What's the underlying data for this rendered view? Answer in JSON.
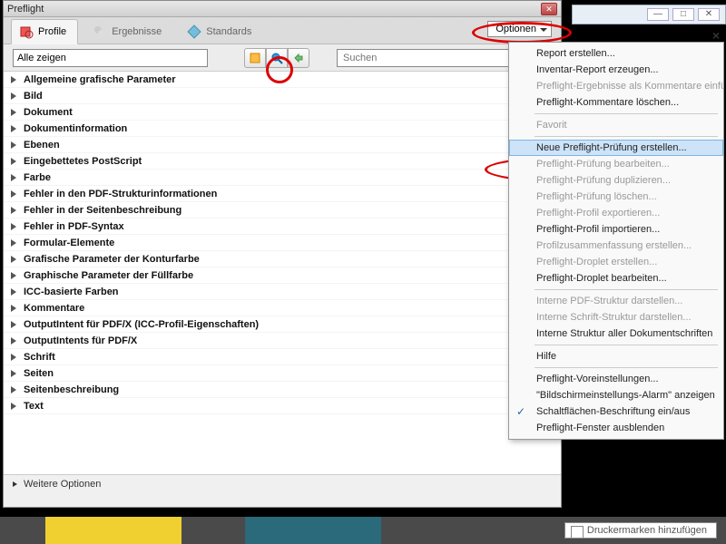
{
  "window": {
    "title": "Preflight"
  },
  "tabs": [
    {
      "label": "Profile"
    },
    {
      "label": "Ergebnisse"
    },
    {
      "label": "Standards"
    }
  ],
  "options_button": "Optionen",
  "filter": {
    "value": "Alle zeigen",
    "search_placeholder": "Suchen"
  },
  "tree": [
    "Allgemeine grafische Parameter",
    "Bild",
    "Dokument",
    "Dokumentinformation",
    "Ebenen",
    "Eingebettetes PostScript",
    "Farbe",
    "Fehler in den PDF-Strukturinformationen",
    "Fehler in der Seitenbeschreibung",
    "Fehler in PDF-Syntax",
    "Formular-Elemente",
    "Grafische Parameter der Konturfarbe",
    "Graphische Parameter der Füllfarbe",
    "ICC-basierte Farben",
    "Kommentare",
    "OutputIntent für PDF/X (ICC-Profil-Eigenschaften)",
    "OutputIntents für PDF/X",
    "Schrift",
    "Seiten",
    "Seitenbeschreibung",
    "Text"
  ],
  "footer": {
    "more_options": "Weitere Optionen"
  },
  "menu": {
    "groups": [
      [
        {
          "label": "Report erstellen..."
        },
        {
          "label": "Inventar-Report erzeugen..."
        },
        {
          "label": "Preflight-Ergebnisse als Kommentare einfügen",
          "disabled": true
        },
        {
          "label": "Preflight-Kommentare löschen..."
        }
      ],
      [
        {
          "label": "Favorit",
          "disabled": true
        }
      ],
      [
        {
          "label": "Neue Preflight-Prüfung erstellen...",
          "highlight": true
        },
        {
          "label": "Preflight-Prüfung bearbeiten...",
          "disabled": true
        },
        {
          "label": "Preflight-Prüfung duplizieren...",
          "disabled": true
        },
        {
          "label": "Preflight-Prüfung löschen...",
          "disabled": true
        },
        {
          "label": "Preflight-Profil exportieren...",
          "disabled": true
        },
        {
          "label": "Preflight-Profil importieren..."
        },
        {
          "label": "Profilzusammenfassung erstellen...",
          "disabled": true
        },
        {
          "label": "Preflight-Droplet erstellen...",
          "disabled": true
        },
        {
          "label": "Preflight-Droplet bearbeiten..."
        }
      ],
      [
        {
          "label": "Interne PDF-Struktur darstellen...",
          "disabled": true
        },
        {
          "label": "Interne Schrift-Struktur darstellen...",
          "disabled": true
        },
        {
          "label": "Interne Struktur aller Dokumentschriften"
        }
      ],
      [
        {
          "label": "Hilfe"
        }
      ],
      [
        {
          "label": "Preflight-Voreinstellungen..."
        },
        {
          "label": "\"Bildschirmeinstellungs-Alarm\" anzeigen"
        },
        {
          "label": "Schaltflächen-Beschriftung ein/aus",
          "checked": true
        },
        {
          "label": "Preflight-Fenster ausblenden"
        }
      ]
    ]
  },
  "status_bar": {
    "label": "Druckermarken hinzufügen"
  }
}
